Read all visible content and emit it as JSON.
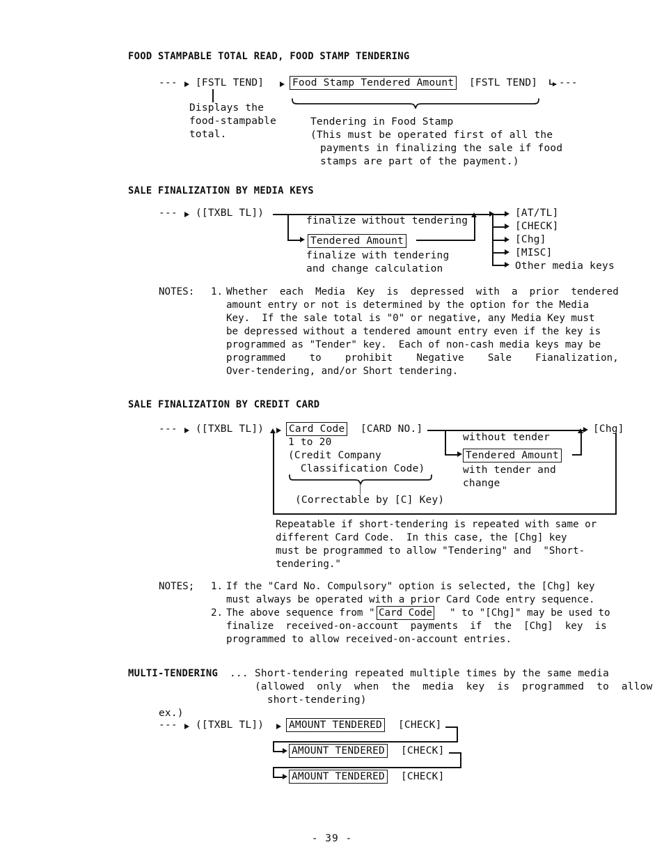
{
  "page": {
    "number_label": "- 39 -"
  },
  "sections": {
    "food_stamp": {
      "heading": "FOOD STAMPABLE TOTAL READ, FOOD STAMP TENDERING",
      "flow": {
        "lead_dashes": "---",
        "key1": "[FSTL TEND]",
        "boxed_amount": "Food Stamp Tendered Amount",
        "key2": "[FSTL TEND]",
        "trail_dashes": "---"
      },
      "left_note": [
        "Displays the",
        "food-stampable",
        "total."
      ],
      "brace_note": [
        "Tendering in Food Stamp",
        "(This must be operated first of all the",
        "payments in finalizing the sale if food",
        "stamps are part of the payment.)"
      ]
    },
    "media_keys": {
      "heading": "SALE FINALIZATION BY MEDIA KEYS",
      "flow": {
        "lead_dashes": "---",
        "start": "([TXBL TL])",
        "branch_top_label": "finalize without tendering",
        "boxed_amount": "Tendered Amount",
        "branch_bottom_label_1": "finalize with tendering",
        "branch_bottom_label_2": "and change calculation"
      },
      "outputs": [
        "[AT/TL]",
        "[CHECK]",
        "[Chg]",
        "[MISC]",
        "Other media keys"
      ],
      "notes_label": "NOTES:",
      "notes": [
        {
          "num": "1.",
          "lines": [
            "Whether  each  Media  Key  is  depressed  with  a  prior  tendered",
            "amount entry or not is determined by the option for the Media",
            "Key.  If the sale total is \"0\" or negative, any Media Key must",
            "be depressed without a tendered amount entry even if the key is",
            "programmed as \"Tender\" key.  Each of non-cash media keys may be",
            "programmed    to    prohibit    Negative    Sale    Fianalization,",
            "Over-tendering, and/or Short tendering."
          ]
        }
      ]
    },
    "credit_card": {
      "heading": "SALE FINALIZATION BY CREDIT CARD",
      "flow": {
        "lead_dashes": "---",
        "start": "([TXBL TL])",
        "boxed_card_code": "Card Code",
        "card_no": "[CARD NO.]",
        "range": "1 to 20",
        "desc_1": "(Credit Company",
        "desc_2": "  Classification Code)",
        "correctable": "(Correctable by [C] Key)",
        "without_tender": "without tender",
        "boxed_amount": "Tendered Amount",
        "with_tender_1": "with tender and",
        "with_tender_2": "change",
        "output": "[Chg]"
      },
      "repeat_note": [
        "Repeatable if short-tendering is repeated with same or",
        "different Card Code.  In this case, the [Chg] key",
        "must be programmed to allow \"Tendering\" and  \"Short-",
        "tendering.\""
      ],
      "notes_label": "NOTES;",
      "notes": [
        {
          "num": "1.",
          "lines": [
            "If the \"Card No. Compulsory\" option is selected, the [Chg] key",
            "must always be operated with a prior Card Code entry sequence."
          ]
        },
        {
          "num": "2.",
          "line_prefix": "The above sequence from \"",
          "boxed": "Card Code",
          "line_suffix": "\" to \"[Chg]\" may be used to",
          "lines_rest": [
            "finalize  received-on-account  payments  if  the  [Chg]  key  is",
            "programmed to allow received-on-account entries."
          ]
        }
      ]
    },
    "multi_tendering": {
      "heading": "MULTI-TENDERING",
      "dots": "...",
      "desc": [
        "Short-tendering repeated multiple times by the same media",
        "(allowed  only  when  the  media  key  is  programmed  to  allow",
        "  short-tendering)"
      ],
      "example_label": "ex.)",
      "flow": {
        "lead_dashes": "---",
        "start": "([TXBL TL])",
        "boxed_amount": "AMOUNT TENDERED",
        "media_key": "[CHECK]"
      },
      "rows": [
        {
          "boxed_amount": "AMOUNT TENDERED",
          "media_key": "[CHECK]"
        },
        {
          "boxed_amount": "AMOUNT TENDERED",
          "media_key": "[CHECK]"
        },
        {
          "boxed_amount": "AMOUNT TENDERED",
          "media_key": "[CHECK]"
        }
      ]
    }
  }
}
